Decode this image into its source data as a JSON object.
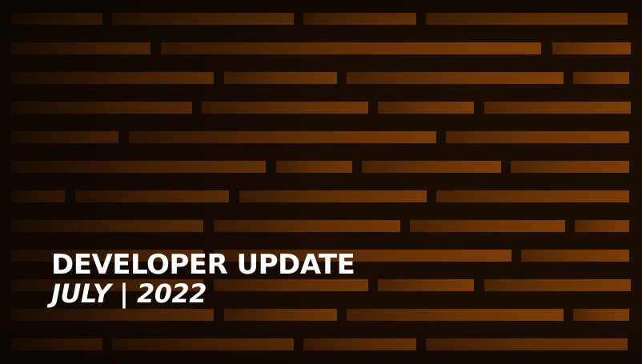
{
  "banner": {
    "headline": "DEVELOPER UPDATE",
    "subline": "JULY | 2022"
  },
  "colors": {
    "background": "#1a0d04",
    "bar": "#6e3606",
    "bar_highlight": "#7d3d07",
    "text": "#ffffff"
  }
}
